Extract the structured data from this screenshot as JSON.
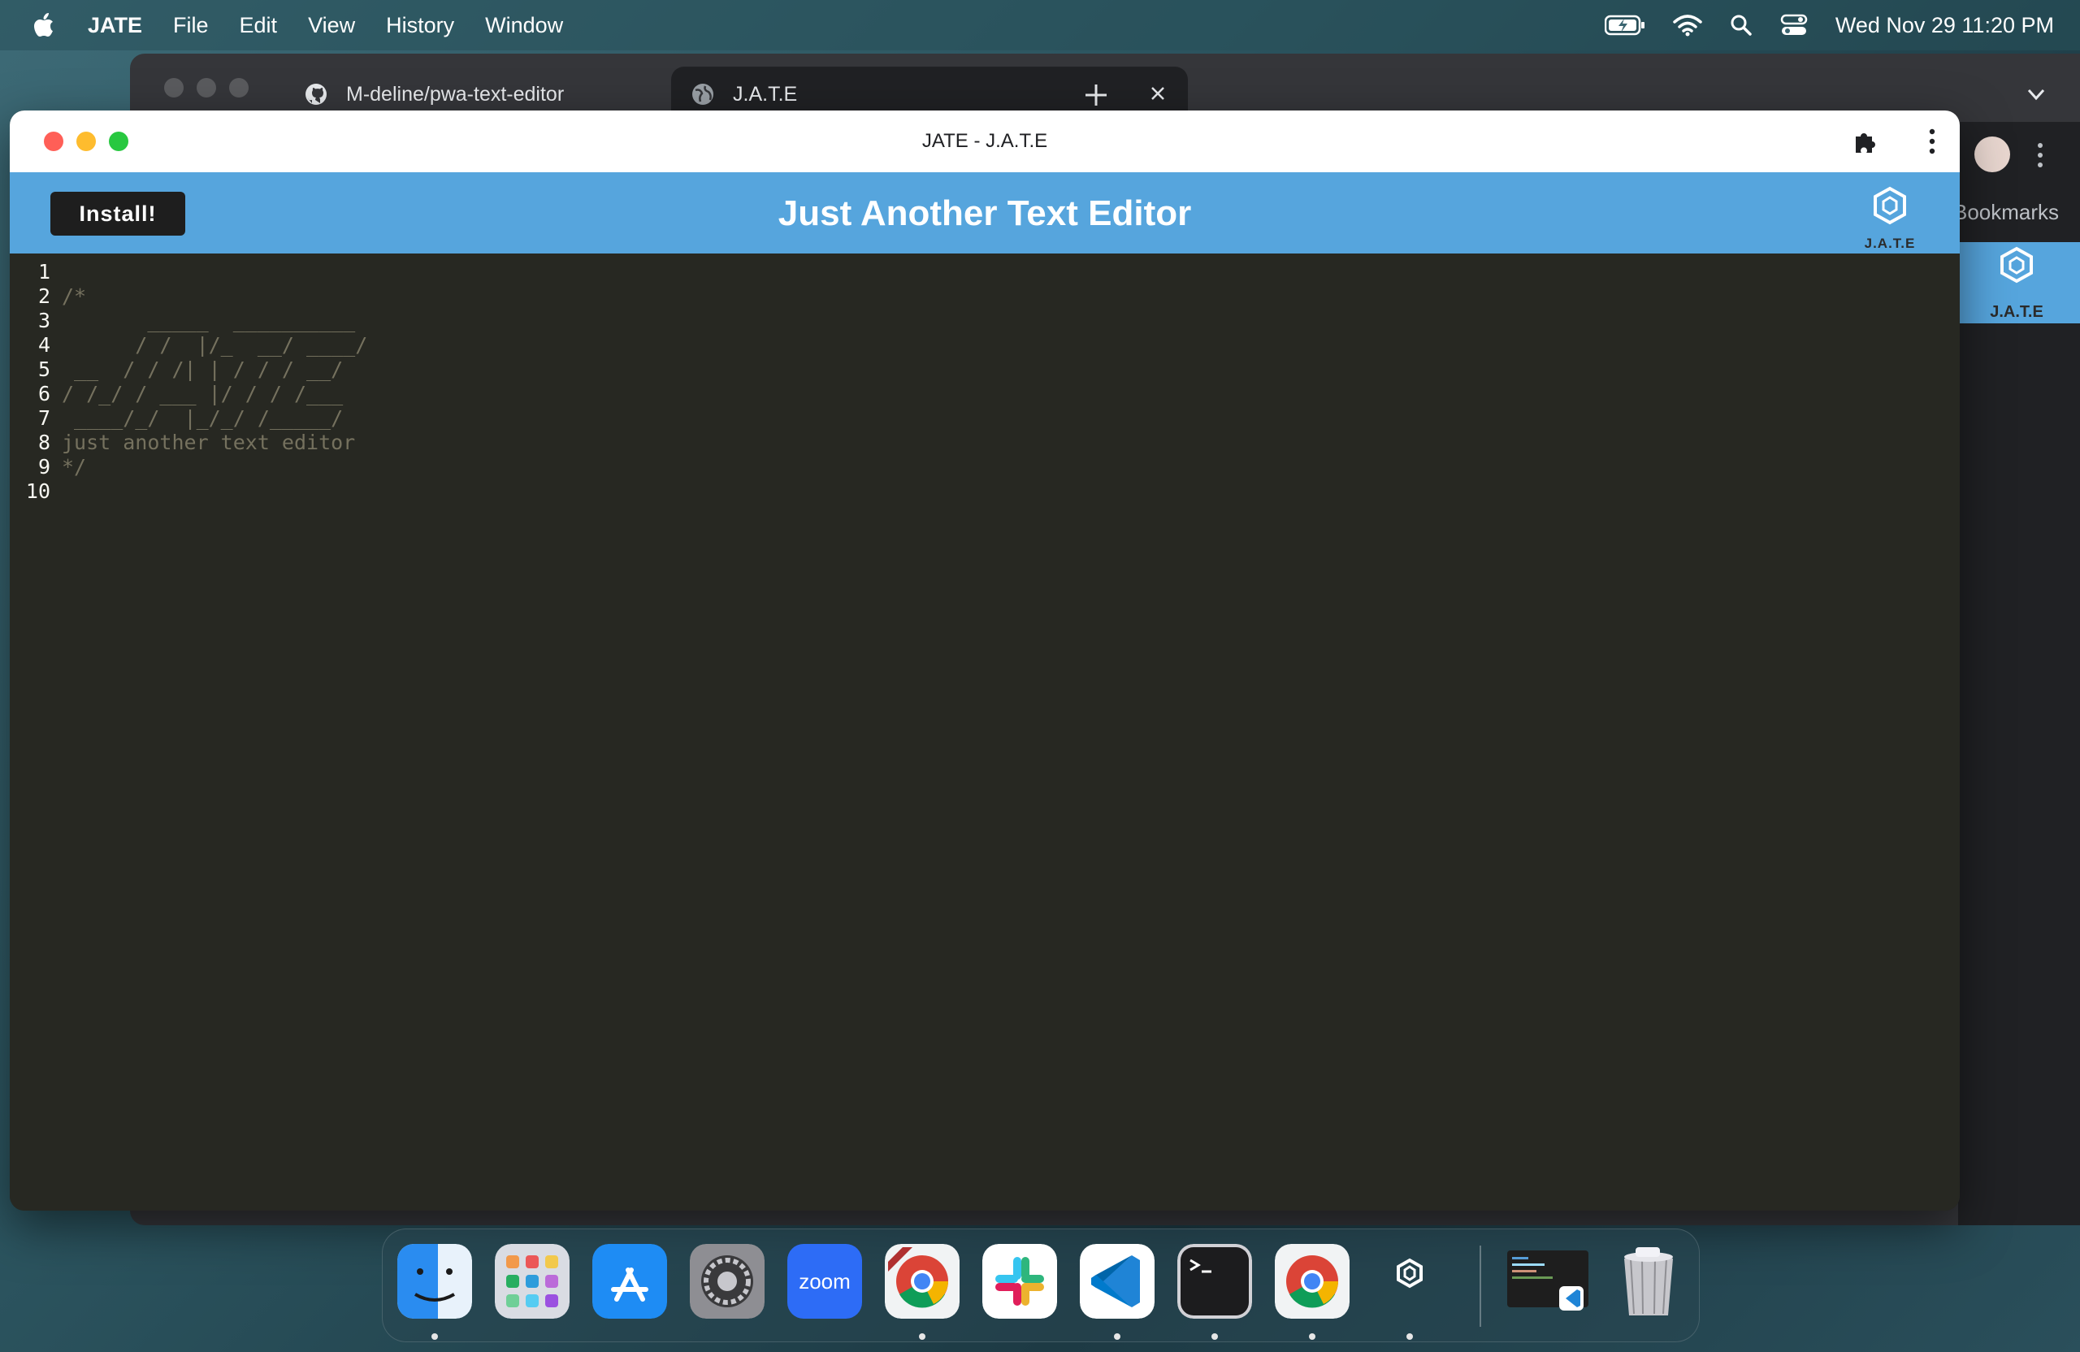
{
  "menubar": {
    "app_name": "JATE",
    "items": [
      "File",
      "Edit",
      "View",
      "History",
      "Window"
    ],
    "datetime": "Wed Nov 29  11:20 PM"
  },
  "browser": {
    "tabs": [
      {
        "label": "M-deline/pwa-text-editor",
        "icon": "github-icon"
      },
      {
        "label": "J.A.T.E",
        "icon": "globe-icon"
      }
    ],
    "bookmarks_label": "Bookmarks"
  },
  "app_window": {
    "title": "JATE - J.A.T.E"
  },
  "app": {
    "install_label": "Install!",
    "title": "Just Another Text Editor",
    "logo_text": "J.A.T.E"
  },
  "editor": {
    "lines": [
      {
        "num": "1",
        "text": ""
      },
      {
        "num": "2",
        "text": "/*"
      },
      {
        "num": "3",
        "text": "       _____  __________"
      },
      {
        "num": "4",
        "text": "      / /  |/_  __/ ____/"
      },
      {
        "num": "5",
        "text": " __  / / /| | / / / __/"
      },
      {
        "num": "6",
        "text": "/ /_/ / ___ |/ / / /___"
      },
      {
        "num": "7",
        "text": " ____/_/  |_/_/ /_____/"
      },
      {
        "num": "8",
        "text": "just another text editor"
      },
      {
        "num": "9",
        "text": "*/"
      },
      {
        "num": "10",
        "text": ""
      }
    ]
  },
  "dock": {
    "apps": [
      "Finder",
      "Launchpad",
      "App Store",
      "System Settings",
      "Zoom",
      "Chrome Dev",
      "Slack",
      "Visual Studio Code",
      "Terminal",
      "Google Chrome",
      "JATE",
      "VS Code Window",
      "Trash"
    ],
    "zoom_label": "zoom"
  }
}
